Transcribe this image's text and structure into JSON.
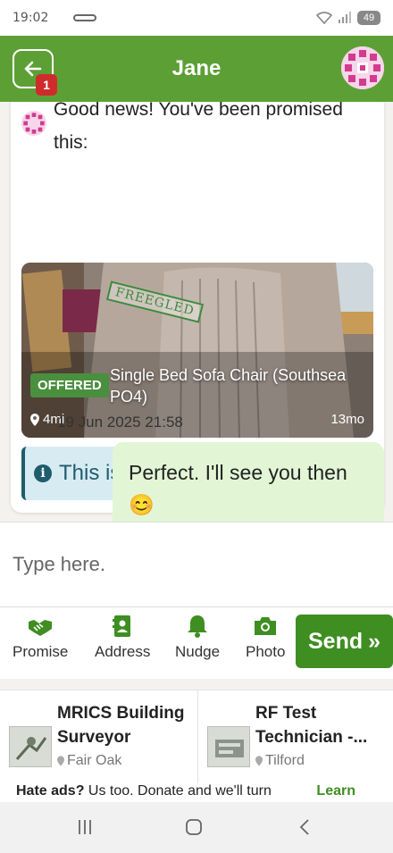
{
  "status_bar": {
    "time": "19:02",
    "battery": "49"
  },
  "header": {
    "title": "Jane",
    "unread_badge": "1",
    "back_icon": "back-arrow-icon"
  },
  "chat": {
    "promise_text": "Good news! You've been promised this:",
    "item": {
      "stamp": "FREEGLED",
      "status": "OFFERED",
      "title": "Single Bed Sofa Chair (Southsea PO4)",
      "distance": "4mi",
      "age": "13mo"
    },
    "notice": "This is no longer available.",
    "timestamp": "19 Jun 2025 21:58",
    "reply": "Perfect. I'll see you then 😊"
  },
  "composer": {
    "placeholder": "Type here."
  },
  "toolbar": {
    "promise": "Promise",
    "address": "Address",
    "nudge": "Nudge",
    "photo": "Photo",
    "send": "Send"
  },
  "ads": {
    "items": [
      {
        "title": "MRICS Building Surveyor",
        "location": "Fair Oak"
      },
      {
        "title": "RF Test Technician -...",
        "location": "Tilford"
      }
    ],
    "banner_bold": "Hate ads?",
    "banner_text": " Us too. Donate and we'll turn",
    "learn": "Learn"
  },
  "colors": {
    "header_green": "#5ca035",
    "send_green": "#3e8e22",
    "bubble": "#e2f6d6",
    "notice_bg": "#d7ecf2"
  }
}
